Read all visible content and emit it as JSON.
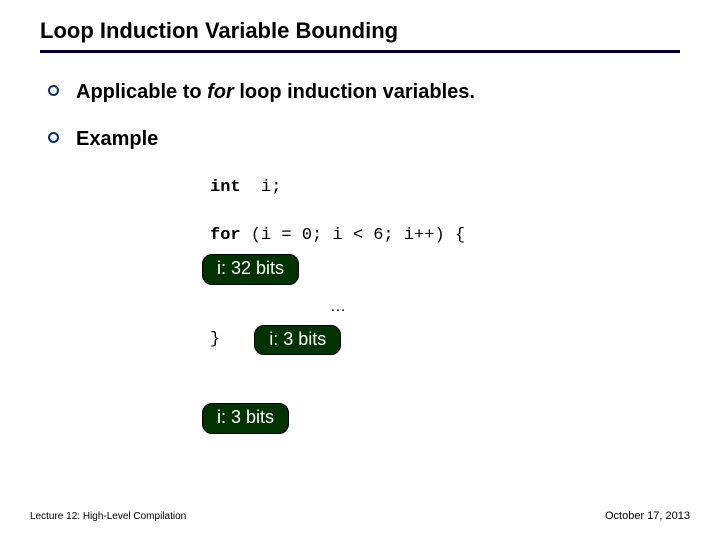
{
  "title": "Loop Induction Variable Bounding",
  "bullets": {
    "b1_pre": "Applicable to ",
    "b1_em": "for",
    "b1_post": " loop induction variables.",
    "b2": "Example"
  },
  "code": {
    "decl_kw": "int",
    "decl_rest": "  i;",
    "for_kw": "for",
    "for_rest": " (i = 0; i < 6; i++) {",
    "dots": "…",
    "close": "}"
  },
  "boxes": {
    "b1": "i: 32 bits",
    "b2": "i: 3 bits",
    "b3": "i: 3 bits"
  },
  "footer": {
    "left": "Lecture 12: High-Level Compilation",
    "right": "October 17, 2013"
  }
}
